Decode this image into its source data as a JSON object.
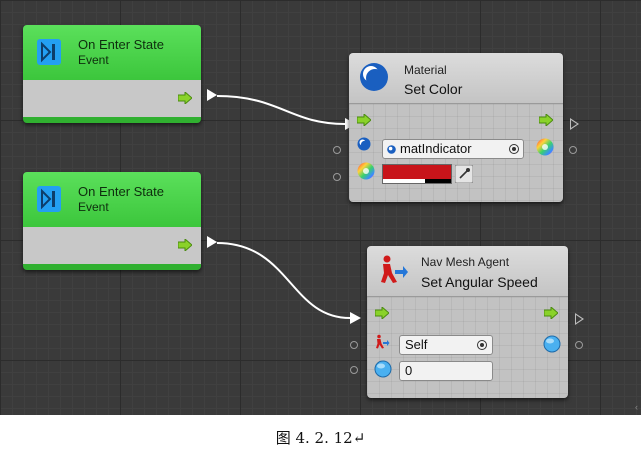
{
  "nodes": {
    "event1": {
      "title": "On Enter State",
      "subtitle": "Event"
    },
    "event2": {
      "title": "On Enter State",
      "subtitle": "Event"
    },
    "set_color": {
      "category": "Material",
      "title": "Set Color",
      "material_field": "matIndicator",
      "color_value": "#c8141a"
    },
    "set_angular_speed": {
      "category": "Nav Mesh Agent",
      "title": "Set Angular Speed",
      "agent_field": "Self",
      "speed_field": "0"
    }
  },
  "icons": [
    "play-step-icon",
    "flow-arrow-icon",
    "sphere-icon",
    "color-wheel-icon",
    "eyedropper-icon",
    "target-picker-icon",
    "nav-agent-icon"
  ],
  "caption": "图 4. 2. 12↵",
  "edge_mark": "‹"
}
